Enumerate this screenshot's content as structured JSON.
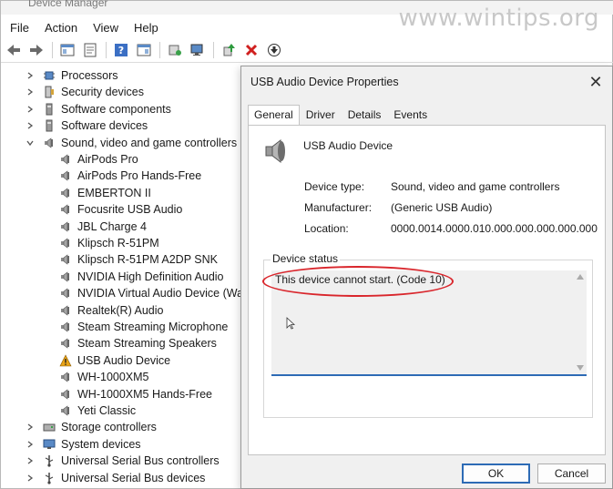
{
  "window": {
    "title": "Device Manager",
    "watermark": "www.wintips.org"
  },
  "menu": [
    "File",
    "Action",
    "View",
    "Help"
  ],
  "toolbar_icons": [
    "back-icon",
    "forward-icon",
    "show-hide-icon",
    "properties-icon",
    "help-icon",
    "console-tree-icon",
    "update-driver-icon",
    "scan-hardware-icon",
    "enable-device-icon",
    "uninstall-icon",
    "download-icon"
  ],
  "tree": {
    "categories_top": [
      {
        "label": "Processors",
        "icon": "processor-icon"
      },
      {
        "label": "Security devices",
        "icon": "security-icon"
      },
      {
        "label": "Software components",
        "icon": "component-icon"
      },
      {
        "label": "Software devices",
        "icon": "component-icon"
      },
      {
        "label": "Sound, video and game controllers",
        "icon": "speaker-icon",
        "expanded": true
      }
    ],
    "sound_children": [
      "AirPods Pro",
      "AirPods Pro Hands-Free",
      "EMBERTON II",
      "Focusrite USB Audio",
      "JBL Charge 4",
      "Klipsch R-51PM",
      "Klipsch R-51PM A2DP SNK",
      "NVIDIA High Definition Audio",
      "NVIDIA Virtual Audio Device (Wav",
      "Realtek(R) Audio",
      "Steam Streaming Microphone",
      "Steam Streaming Speakers",
      "USB Audio Device",
      "WH-1000XM5",
      "WH-1000XM5 Hands-Free",
      "Yeti Classic"
    ],
    "warning_item": "USB Audio Device",
    "categories_bottom": [
      {
        "label": "Storage controllers",
        "icon": "storage-icon"
      },
      {
        "label": "System devices",
        "icon": "system-icon"
      },
      {
        "label": "Universal Serial Bus controllers",
        "icon": "usb-icon"
      },
      {
        "label": "Universal Serial Bus devices",
        "icon": "usb-icon"
      }
    ]
  },
  "dialog": {
    "title": "USB Audio Device Properties",
    "tabs": [
      "General",
      "Driver",
      "Details",
      "Events"
    ],
    "active_tab": "General",
    "device_name": "USB Audio Device",
    "properties": [
      {
        "label": "Device type:",
        "value": "Sound, video and game controllers"
      },
      {
        "label": "Manufacturer:",
        "value": "(Generic USB Audio)"
      },
      {
        "label": "Location:",
        "value": "0000.0014.0000.010.000.000.000.000.000"
      }
    ],
    "status_legend": "Device status",
    "status_text": "This device cannot start. (Code 10)",
    "ok_label": "OK",
    "cancel_label": "Cancel"
  },
  "colors": {
    "highlight": "#d9262c",
    "accent": "#2d6bb5",
    "warning": "#e8a317"
  }
}
